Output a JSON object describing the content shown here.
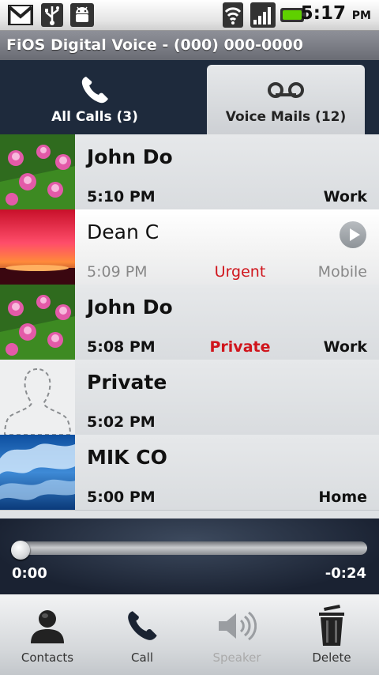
{
  "status_bar": {
    "icons": [
      "gmail-icon",
      "usb-icon",
      "android-debug-icon",
      "wifi-icon",
      "signal-icon",
      "battery-icon"
    ],
    "time": "5:17",
    "ampm": "PM"
  },
  "title_bar": {
    "title": "FiOS Digital Voice -  (000) 000-0000"
  },
  "tabs": [
    {
      "label": "All Calls (3)",
      "icon": "phone-icon",
      "selected": false
    },
    {
      "label": "Voice Mails (12)",
      "icon": "voicemail-icon",
      "selected": true
    }
  ],
  "voicemails": [
    {
      "name": "John Do",
      "time": "5:10 PM",
      "flag": "",
      "type": "Work",
      "thumb": "water-lily-photo"
    },
    {
      "name": "Dean C",
      "time": "5:09 PM",
      "flag": "Urgent",
      "type": "Mobile",
      "thumb": "sunset-photo",
      "selected": true
    },
    {
      "name": "John Do",
      "time": "5:08 PM",
      "flag": "Private",
      "type": "Work",
      "thumb": "water-lily-photo"
    },
    {
      "name": "Private",
      "time": "5:02 PM",
      "flag": "",
      "type": "",
      "thumb": "default-contact-silhouette"
    },
    {
      "name": "MIK CO",
      "time": "5:00 PM",
      "flag": "",
      "type": "Home",
      "thumb": "wave-photo"
    }
  ],
  "player": {
    "elapsed": "0:00",
    "remaining": "-0:24",
    "progress": 0.0
  },
  "toolbar": {
    "contacts": "Contacts",
    "call": "Call",
    "speaker": "Speaker",
    "delete": "Delete"
  },
  "colors": {
    "accent_red": "#d0151c",
    "tab_bg": "#1e2a3c",
    "player_bg": "#1a2232"
  }
}
